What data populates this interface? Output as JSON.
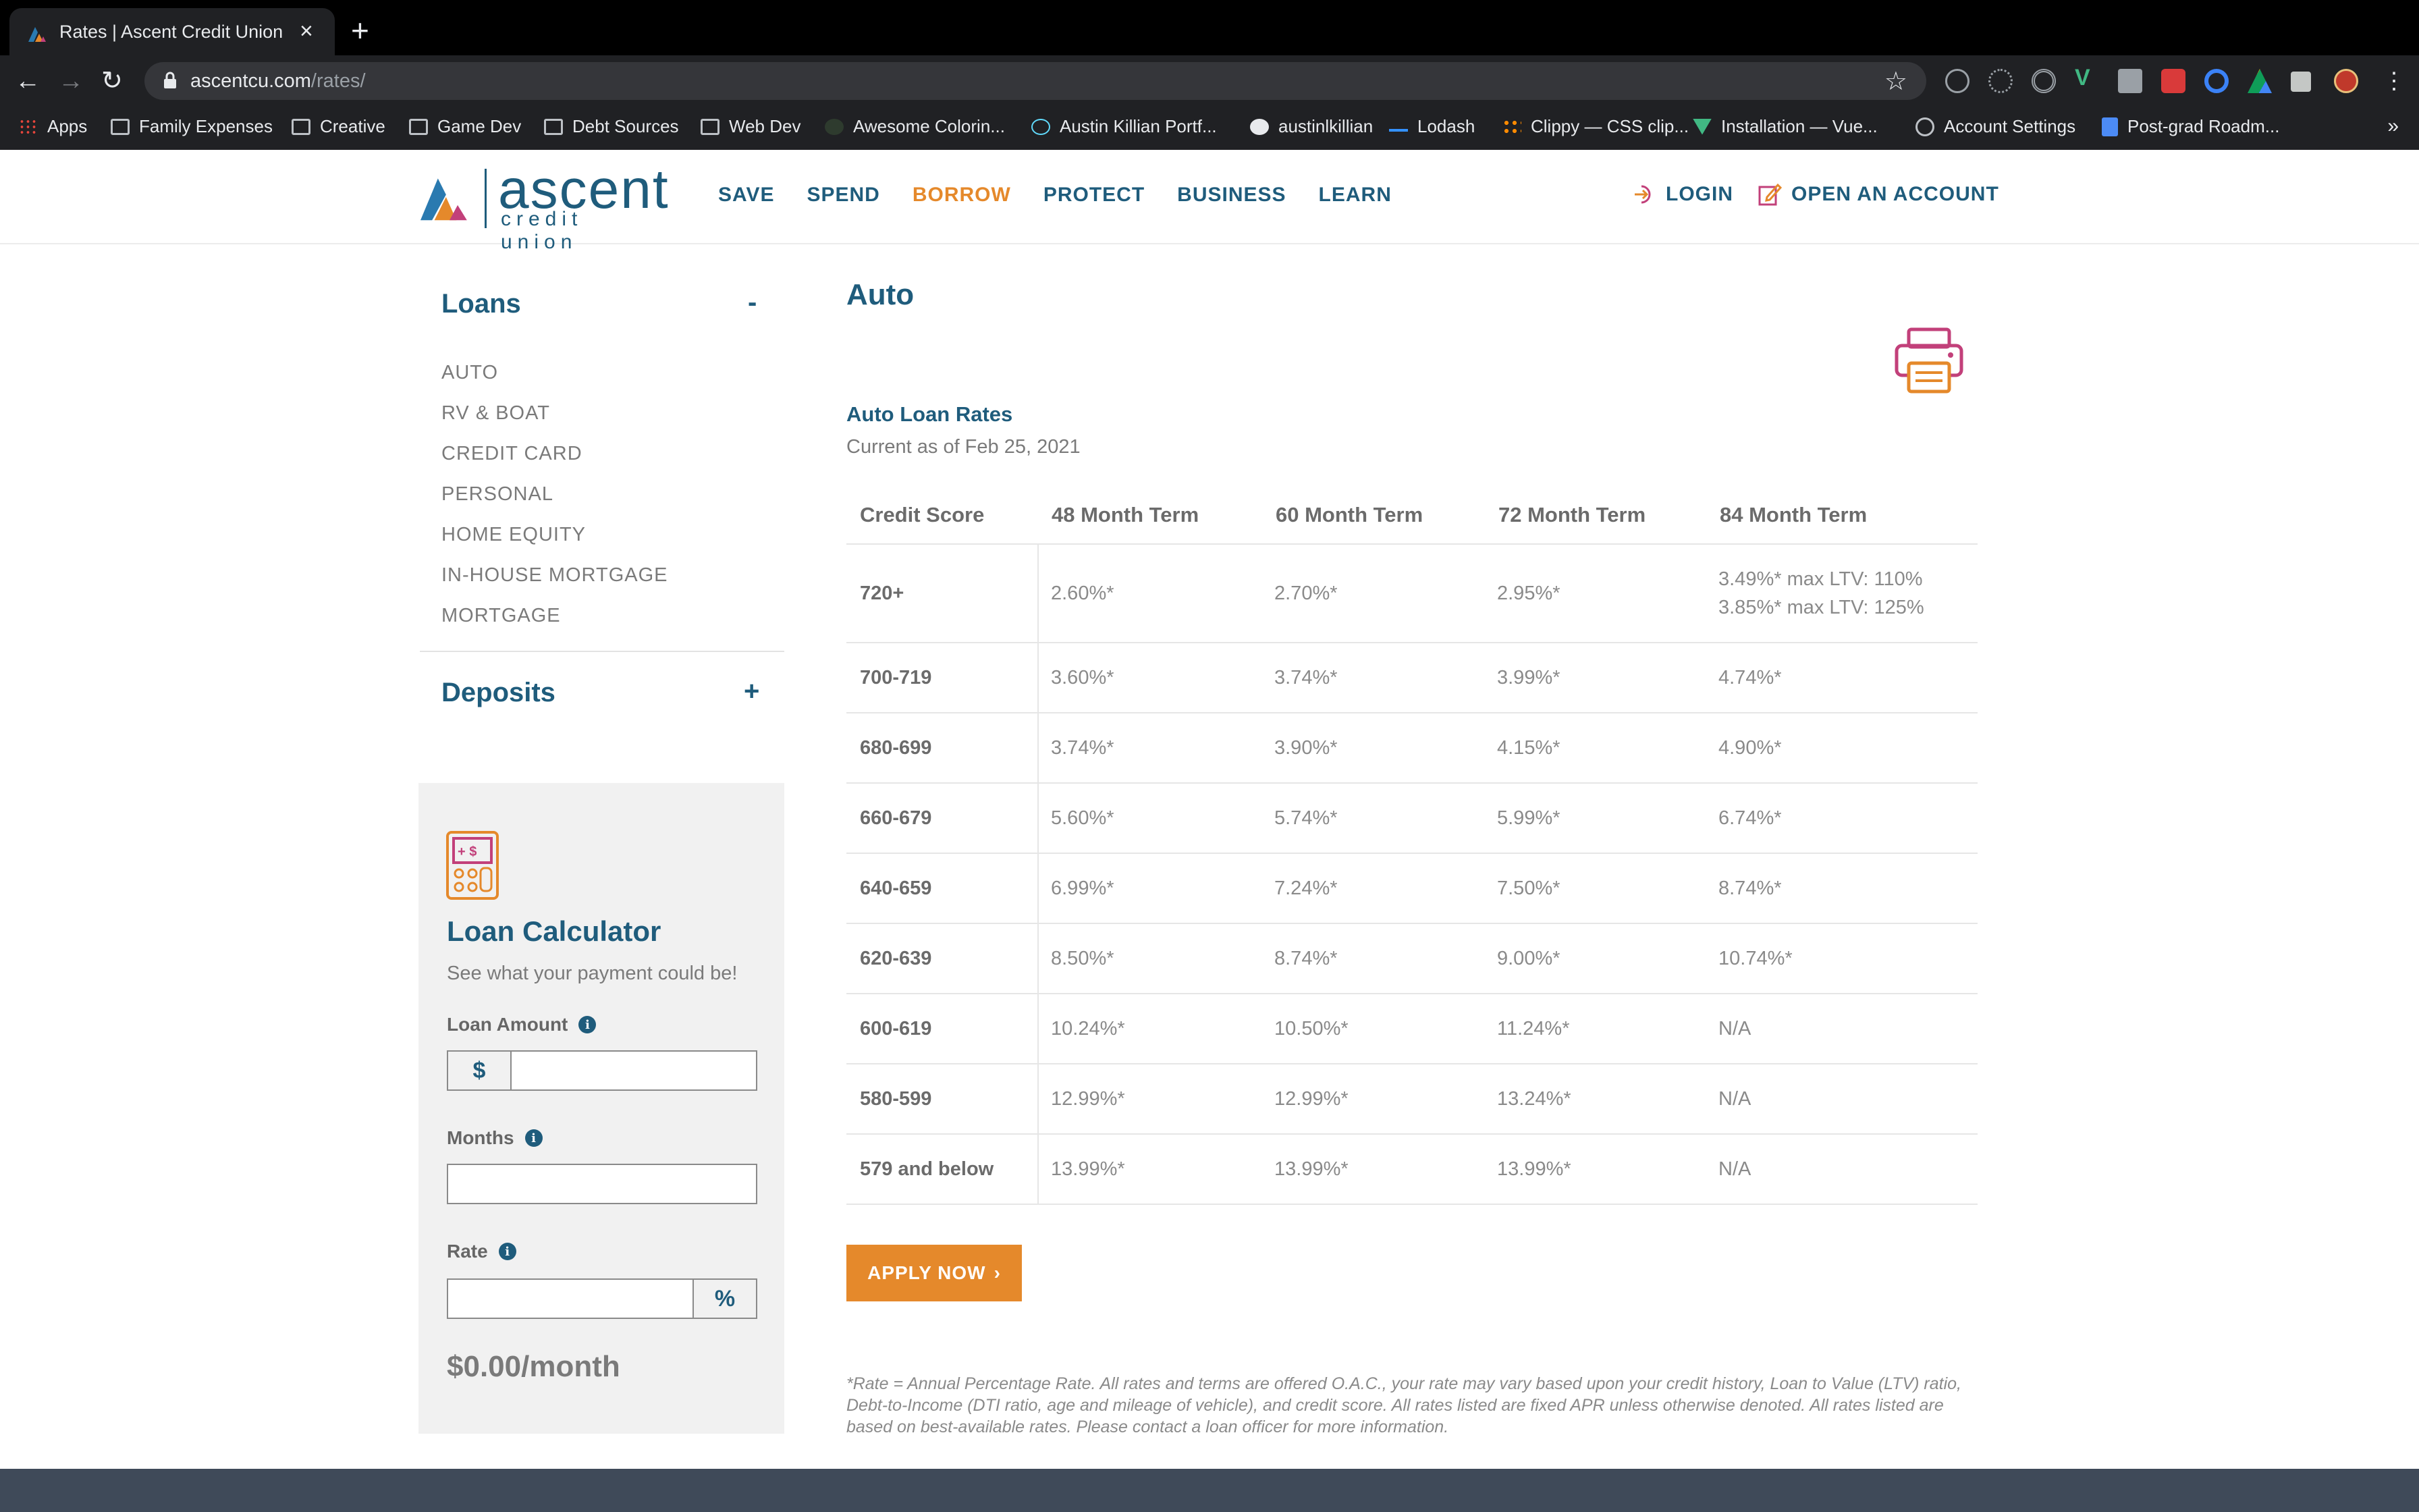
{
  "browser": {
    "tab_title": "Rates | Ascent Credit Union",
    "url_domain": "ascentcu.com",
    "url_path": "/rates/",
    "bookmarks": [
      "Apps",
      "Family Expenses",
      "Creative",
      "Game Dev",
      "Debt Sources",
      "Web Dev",
      "Awesome Colorin...",
      "Austin Killian Portf...",
      "austinlkillian",
      "Lodash",
      "Clippy — CSS clip...",
      "Installation — Vue...",
      "Account Settings",
      "Post-grad Roadm..."
    ],
    "bookmarks_more": "»"
  },
  "site": {
    "logo_word": "ascent",
    "logo_sub": "credit union",
    "nav": [
      "SAVE",
      "SPEND",
      "BORROW",
      "PROTECT",
      "BUSINESS",
      "LEARN"
    ],
    "nav_active": "BORROW",
    "login": "LOGIN",
    "open_account": "OPEN AN ACCOUNT",
    "brand_blue": "#1f5c7c",
    "brand_orange": "#e5892b"
  },
  "sidebar": {
    "loans_title": "Loans",
    "loans_toggle": "-",
    "loan_items": [
      "AUTO",
      "RV & BOAT",
      "CREDIT CARD",
      "PERSONAL",
      "HOME EQUITY",
      "IN-HOUSE MORTGAGE",
      "MORTGAGE"
    ],
    "deposits_title": "Deposits",
    "deposits_toggle": "+"
  },
  "calculator": {
    "title": "Loan Calculator",
    "subtitle": "See what your payment could be!",
    "amount_label": "Loan Amount",
    "amount_prefix": "$",
    "amount_value": "",
    "months_label": "Months",
    "months_value": "",
    "rate_label": "Rate",
    "rate_suffix": "%",
    "rate_value": "",
    "result": "$0.00/month"
  },
  "main": {
    "page_title": "Auto",
    "section_title": "Auto Loan Rates",
    "as_of": "Current as of Feb 25, 2021",
    "table": {
      "headers": [
        "Credit Score",
        "48 Month Term",
        "60 Month Term",
        "72 Month Term",
        "84 Month Term"
      ],
      "rows": [
        [
          "720+",
          "2.60%*",
          "2.70%*",
          "2.95%*",
          "3.49%* max LTV: 110%",
          "3.85%* max LTV: 125%"
        ],
        [
          "700-719",
          "3.60%*",
          "3.74%*",
          "3.99%*",
          "4.74%*"
        ],
        [
          "680-699",
          "3.74%*",
          "3.90%*",
          "4.15%*",
          "4.90%*"
        ],
        [
          "660-679",
          "5.60%*",
          "5.74%*",
          "5.99%*",
          "6.74%*"
        ],
        [
          "640-659",
          "6.99%*",
          "7.24%*",
          "7.50%*",
          "8.74%*"
        ],
        [
          "620-639",
          "8.50%*",
          "8.74%*",
          "9.00%*",
          "10.74%*"
        ],
        [
          "600-619",
          "10.24%*",
          "10.50%*",
          "11.24%*",
          "N/A"
        ],
        [
          "580-599",
          "12.99%*",
          "12.99%*",
          "13.24%*",
          "N/A"
        ],
        [
          "579 and below",
          "13.99%*",
          "13.99%*",
          "13.99%*",
          "N/A"
        ]
      ]
    },
    "apply_label": "APPLY NOW",
    "apply_chevron": "›",
    "footnote": "*Rate = Annual Percentage Rate. All rates and terms are offered O.A.C., your rate may vary based upon your credit history, Loan to Value (LTV) ratio, Debt-to-Income (DTI ratio, age and mileage of vehicle), and credit score. All rates listed are fixed APR unless otherwise denoted. All rates listed are based on best-available rates. Please contact a loan officer for more information."
  }
}
